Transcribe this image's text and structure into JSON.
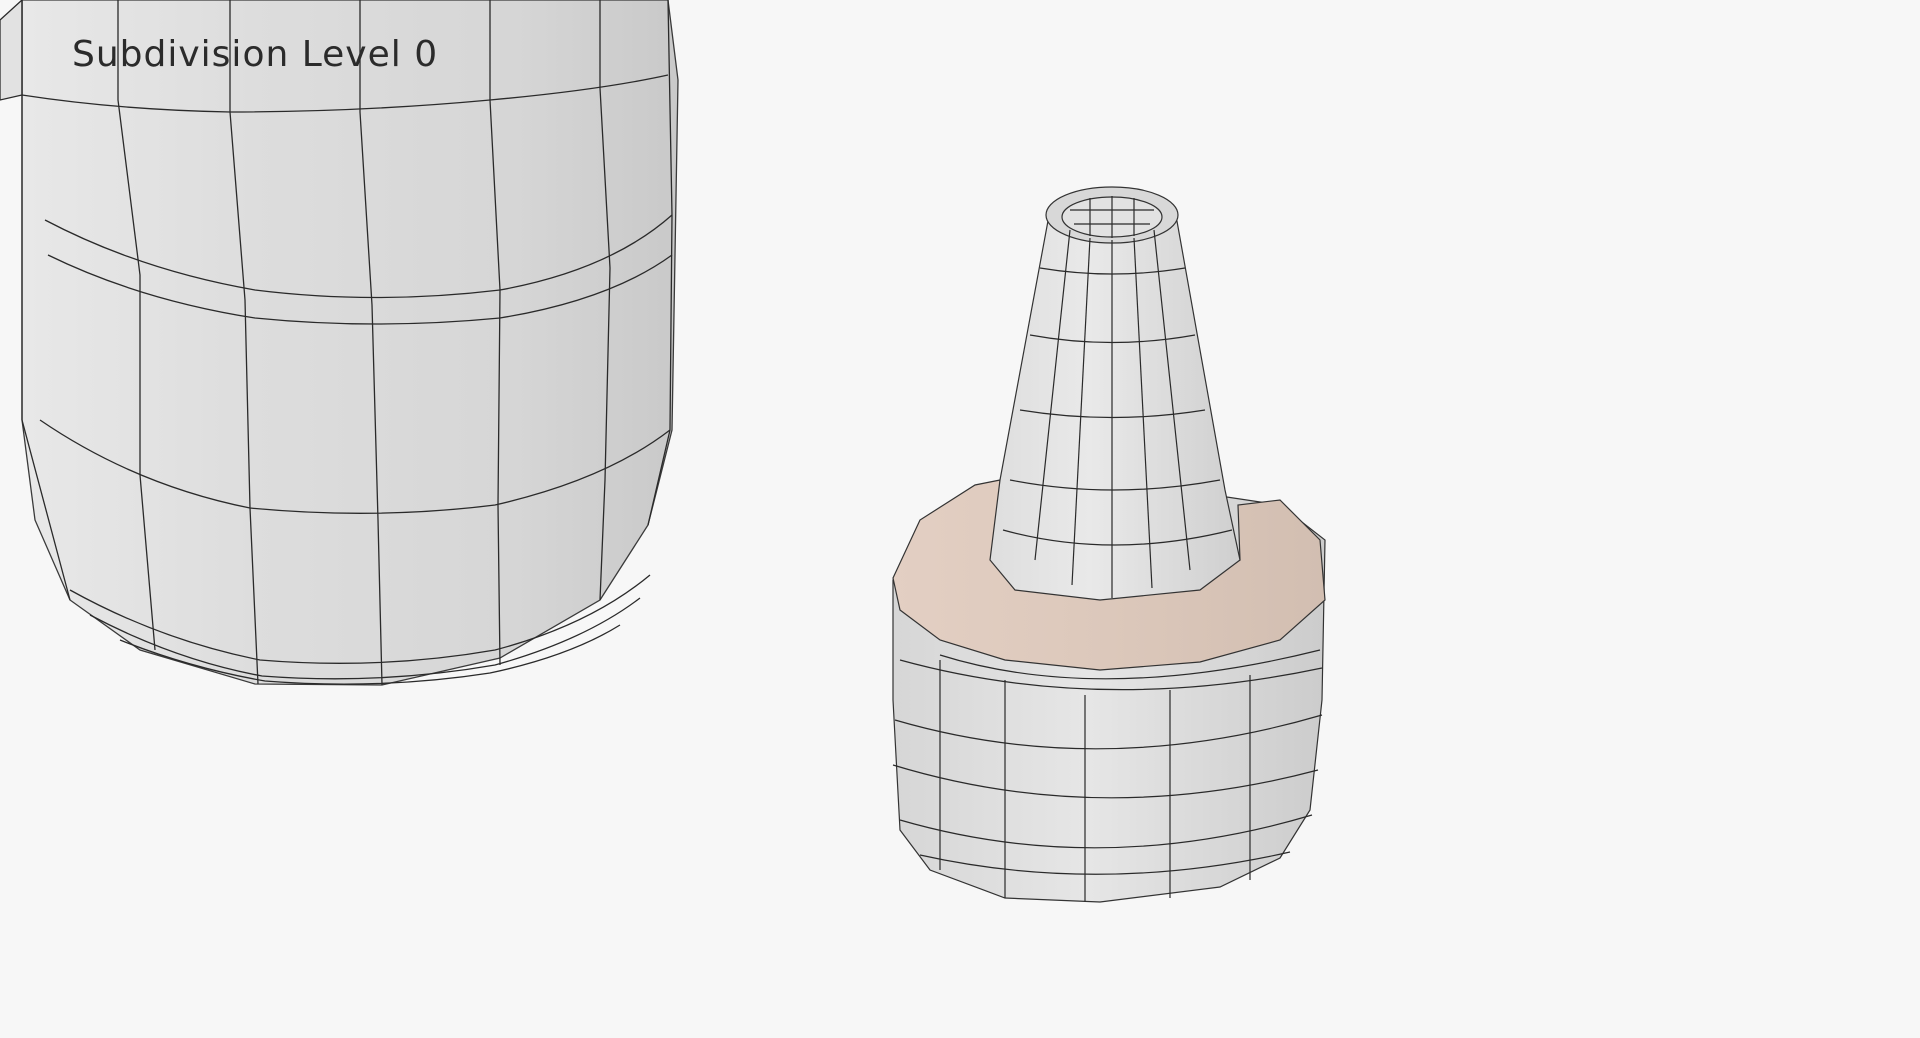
{
  "viewport": {
    "label": "Subdivision Level 0",
    "background": "#f7f7f7",
    "wire_color": "#2a2a2a",
    "surface_color": "#dcdcdc",
    "accent_color": "#d9c2b4"
  }
}
